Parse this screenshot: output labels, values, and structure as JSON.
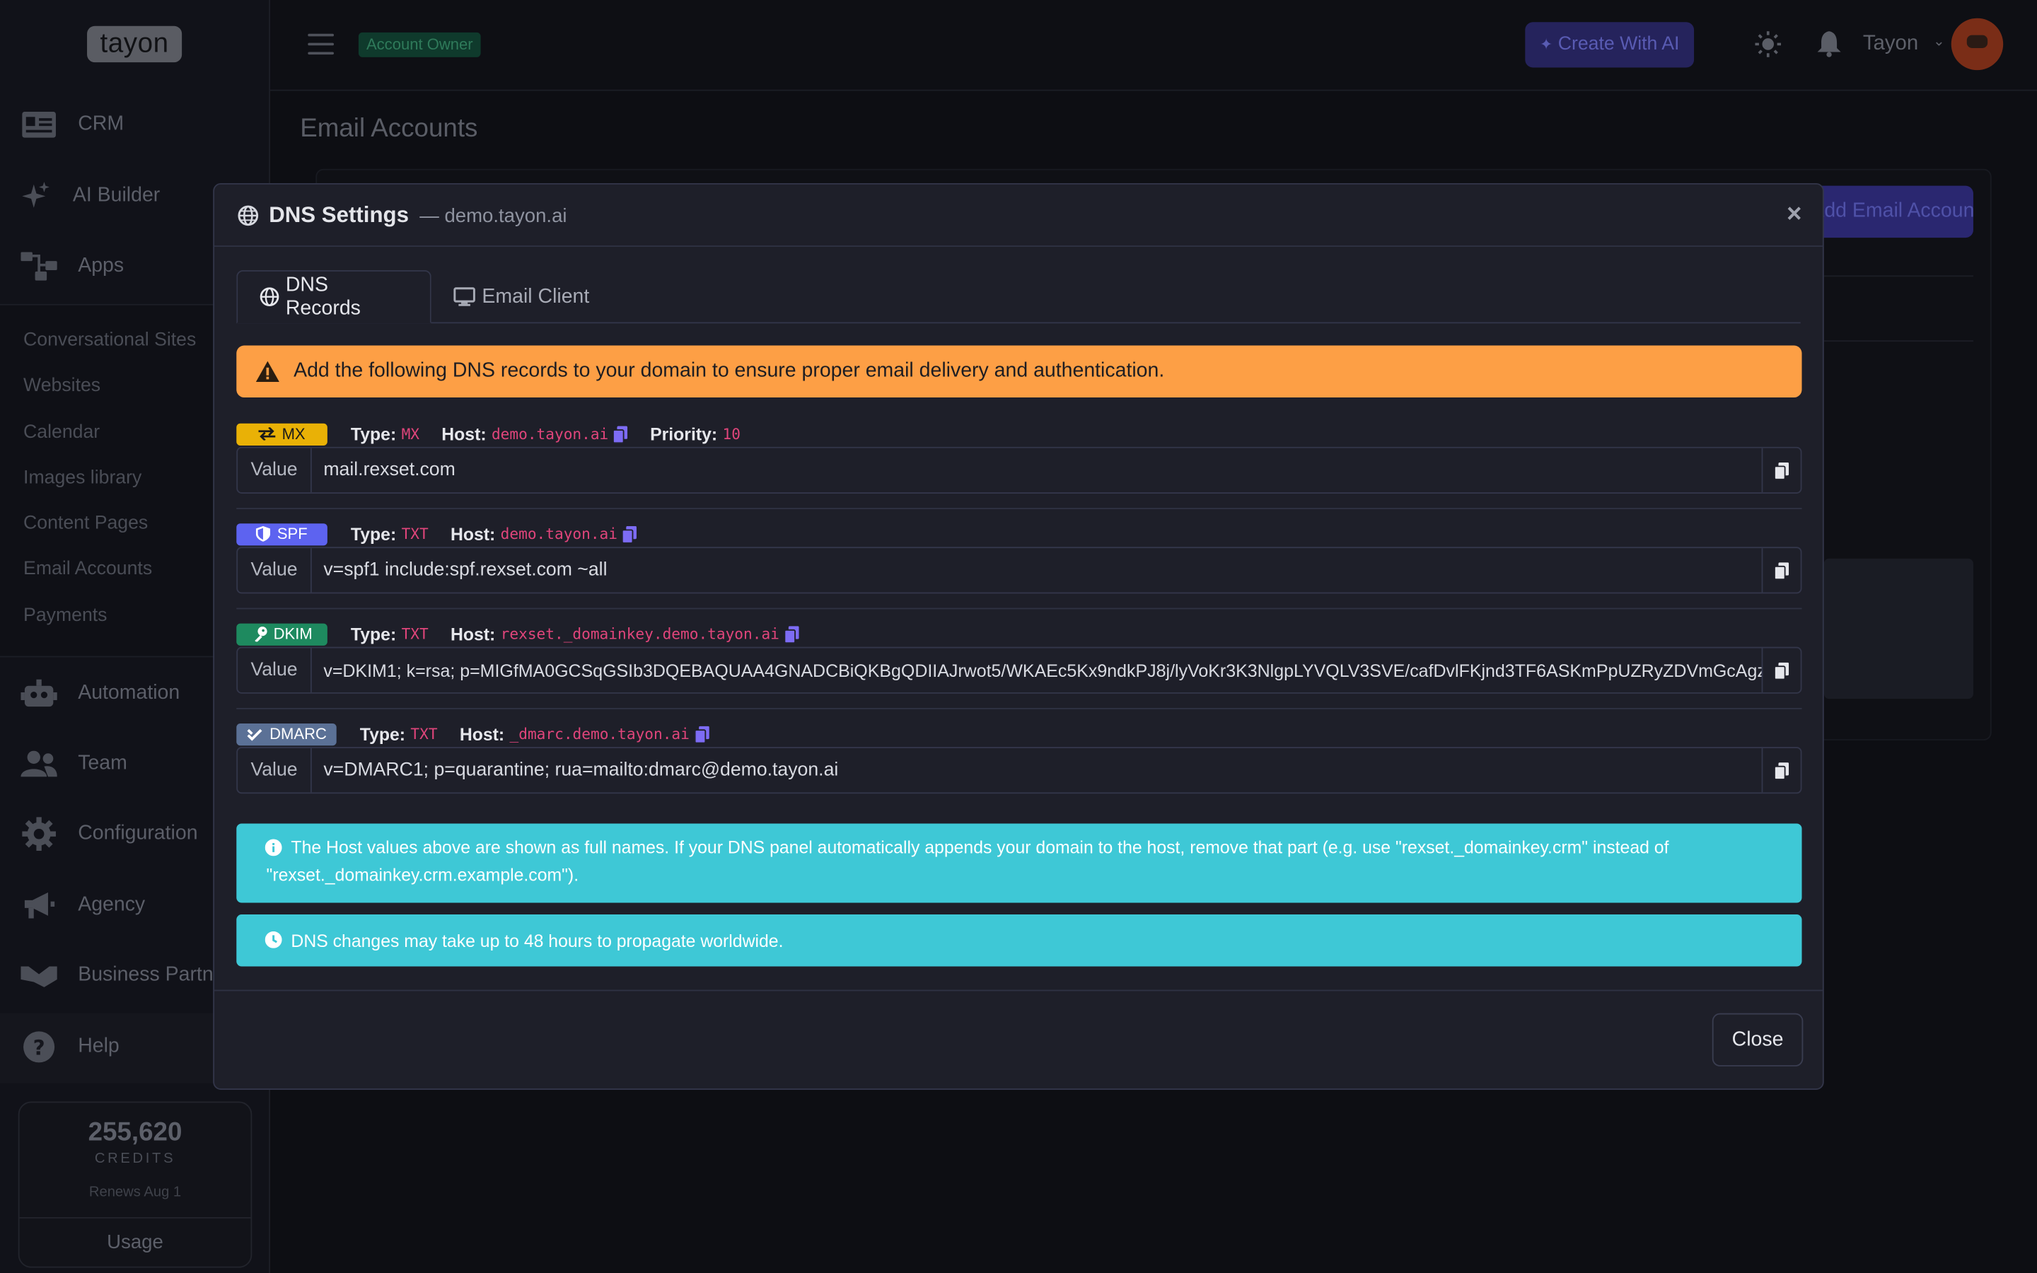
{
  "app": {
    "logo_text": "tayon"
  },
  "sidebar": {
    "main_items": [
      {
        "label": "CRM",
        "icon": "id-card-icon"
      },
      {
        "label": "AI Builder",
        "icon": "sparkles-icon"
      },
      {
        "label": "Apps",
        "icon": "sitemap-icon"
      }
    ],
    "sub_items": [
      "Conversational Sites",
      "Websites",
      "Calendar",
      "Images library",
      "Content Pages",
      "Email Accounts",
      "Payments"
    ],
    "lower_items": [
      {
        "label": "Automation",
        "icon": "robot-icon"
      },
      {
        "label": "Team",
        "icon": "users-icon"
      },
      {
        "label": "Configuration",
        "icon": "gear-icon"
      },
      {
        "label": "Agency",
        "icon": "megaphone-icon"
      },
      {
        "label": "Business Partners",
        "icon": "handshake-icon"
      },
      {
        "label": "Help",
        "icon": "question-circle-icon"
      }
    ],
    "credits": {
      "amount": "255,620",
      "label": "CREDITS",
      "renews": "Renews Aug 1",
      "usage_label": "Usage"
    }
  },
  "topbar": {
    "role_badge": "Account Owner",
    "create_ai_label": "Create With AI",
    "user_name": "Tayon"
  },
  "page": {
    "title": "Email Accounts",
    "add_button": "Add Email Account"
  },
  "modal": {
    "title": "DNS Settings",
    "domain": "— demo.tayon.ai",
    "close_glyph": "×",
    "tabs": [
      {
        "label": "DNS Records",
        "active": true
      },
      {
        "label": "Email Client",
        "active": false
      }
    ],
    "warning": "Add the following DNS records to your domain to ensure proper email delivery and authentication.",
    "records": [
      {
        "badge": "MX",
        "type_key": "Type:",
        "type": "MX",
        "host_key": "Host:",
        "host": "demo.tayon.ai",
        "priority_key": "Priority:",
        "priority": "10",
        "value_label": "Value",
        "value": "mail.rexset.com"
      },
      {
        "badge": "SPF",
        "type_key": "Type:",
        "type": "TXT",
        "host_key": "Host:",
        "host": "demo.tayon.ai",
        "value_label": "Value",
        "value": "v=spf1 include:spf.rexset.com ~all"
      },
      {
        "badge": "DKIM",
        "type_key": "Type:",
        "type": "TXT",
        "host_key": "Host:",
        "host": "rexset._domainkey.demo.tayon.ai",
        "value_label": "Value",
        "value": "v=DKIM1; k=rsa; p=MIGfMA0GCSqGSIb3DQEBAQUAA4GNADCBiQKBgQDIIAJrwot5/WKAEc5Kx9ndkPJ8j/lyVoKr3K3NlgpLYVQLV3SVE/cafDvlFKjnd3TF6ASKmPpUZRyZDVmGcAgz"
      },
      {
        "badge": "DMARC",
        "type_key": "Type:",
        "type": "TXT",
        "host_key": "Host:",
        "host": "_dmarc.demo.tayon.ai",
        "value_label": "Value",
        "value": "v=DMARC1; p=quarantine; rua=mailto:dmarc@demo.tayon.ai"
      }
    ],
    "info_host": "The Host values above are shown as full names. If your DNS panel automatically appends your domain to the host, remove that part (e.g. use \"rexset._domainkey.crm\" instead of \"rexset._domainkey.crm.example.com\").",
    "info_propagate": "DNS changes may take up to 48 hours to propagate worldwide.",
    "close_button": "Close"
  },
  "colors": {
    "warning_bg": "#fd9f45",
    "info_bg": "#3ec8d6",
    "mx_badge": "#e9b106",
    "spf_badge": "#5d63f0",
    "dkim_badge": "#1e8a5f",
    "dmarc_badge": "#5b7196",
    "code_text": "#e0457b",
    "copy_icon": "#7d6cf5"
  }
}
